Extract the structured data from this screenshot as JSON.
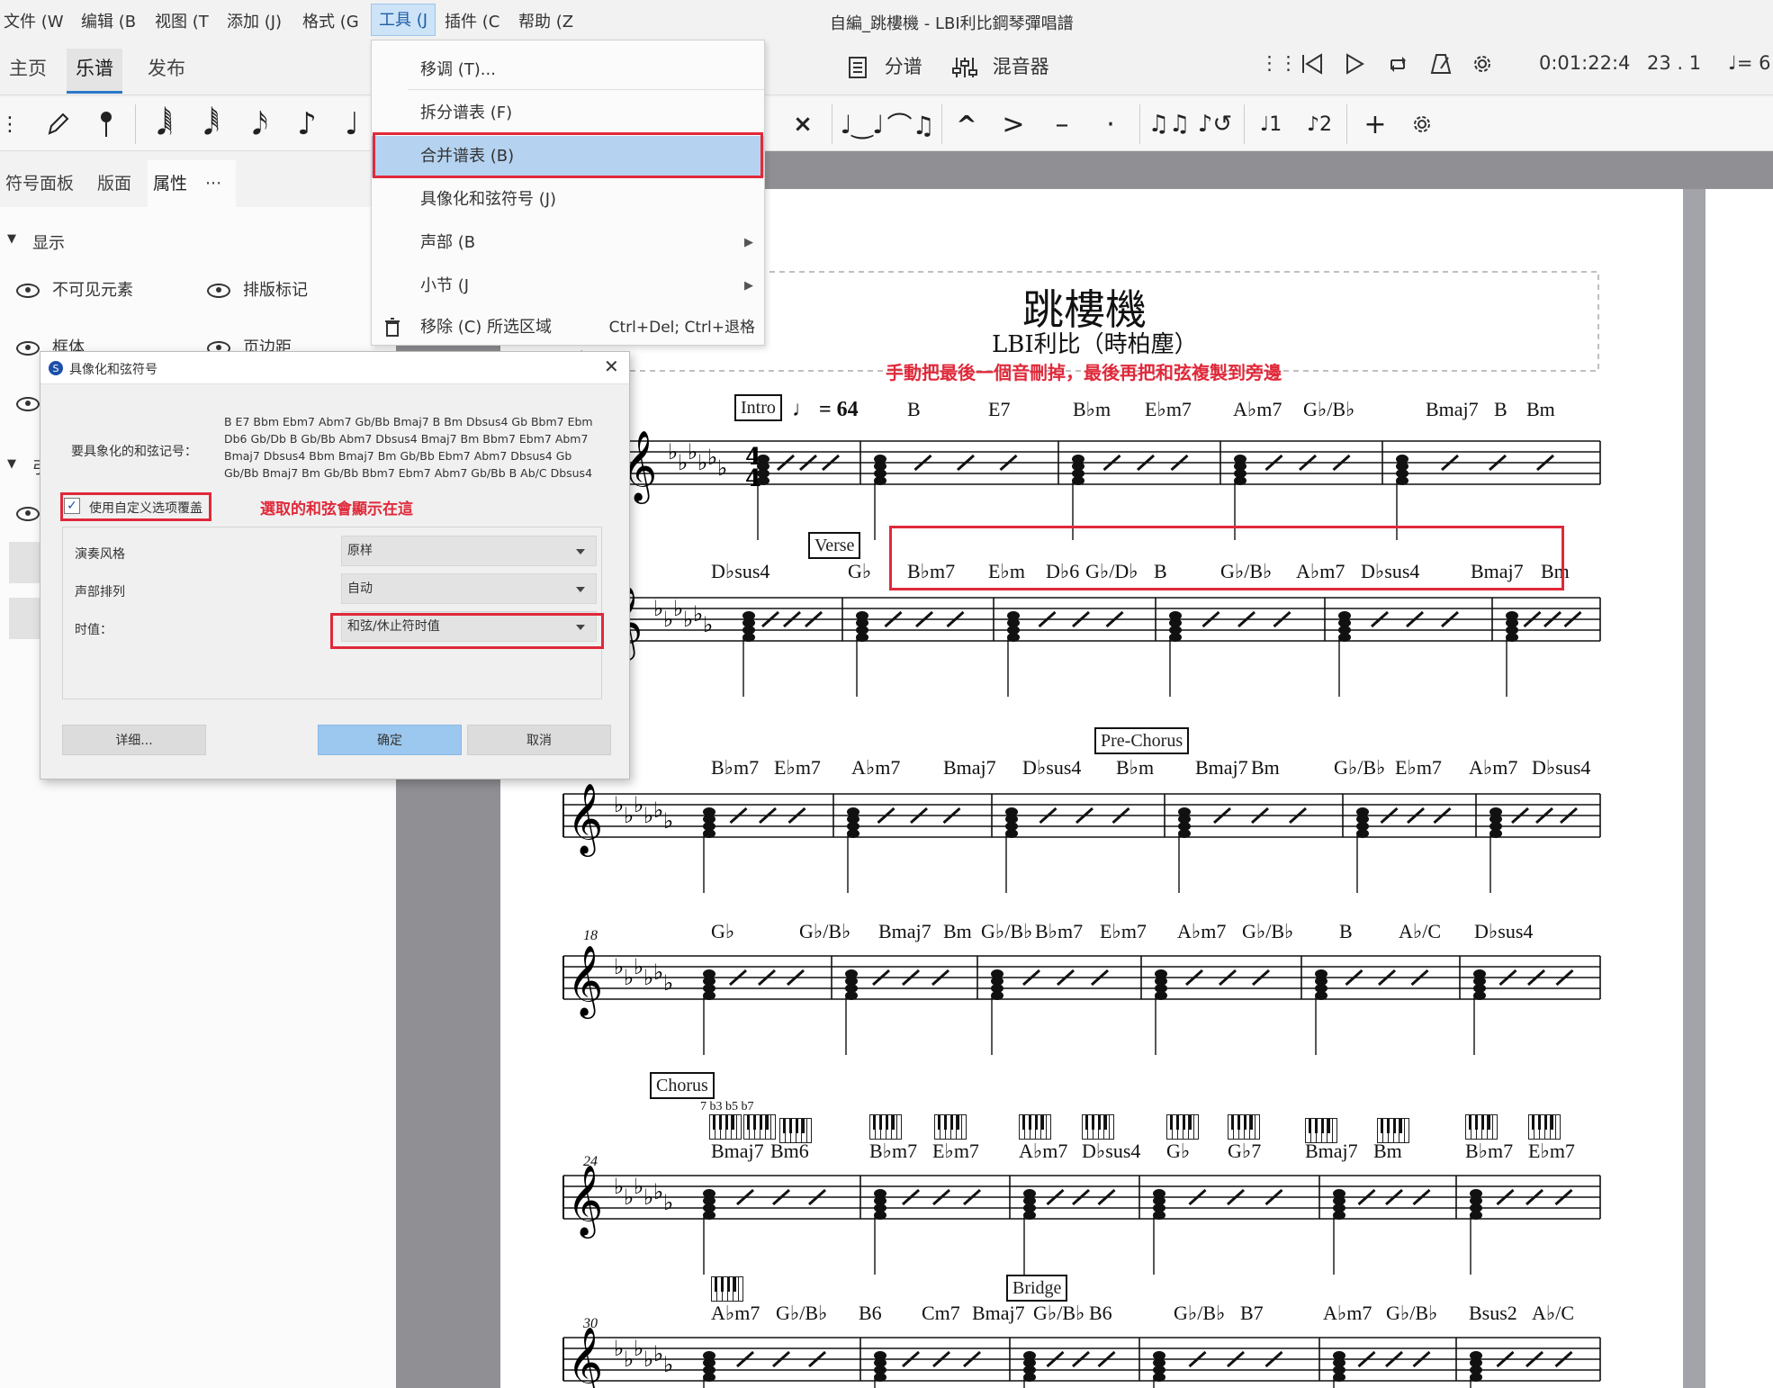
{
  "window": {
    "title": "自編_跳樓機 - LBI利比鋼琴彈唱譜"
  },
  "menubar": [
    "文件 (W",
    "编辑 (B",
    "视图 (T",
    "添加 (J)",
    "格式 (G",
    "工具 (J",
    "插件 (C",
    "帮助 (Z"
  ],
  "main_tabs": [
    "主页",
    "乐谱",
    "发布"
  ],
  "right_toolbar": {
    "parts_label": "分谱",
    "mixer_label": "混音器",
    "time": "0:01:22:4",
    "position": "23 . 1",
    "tempo_prefix": "= 6"
  },
  "left_panel": {
    "tabs": [
      "符号面板",
      "版面",
      "属性"
    ],
    "more": "···",
    "section_display": "显示",
    "items": [
      "不可见元素",
      "排版标记",
      "框体",
      "页边距"
    ],
    "section2_partial": "引"
  },
  "tools_menu": {
    "items": [
      {
        "label": "移调 (T)...",
        "submenu": false
      },
      {
        "label": "拆分谱表 (F)",
        "submenu": false
      },
      {
        "label": "合并谱表 (B)",
        "submenu": false,
        "highlighted": true
      },
      {
        "label": "具像化和弦符号 (J)",
        "submenu": false
      },
      {
        "label": "声部 (B",
        "submenu": true
      },
      {
        "label": "小节 (J",
        "submenu": true
      },
      {
        "label": "移除 (C) 所选区域",
        "submenu": false,
        "shortcut": "Ctrl+Del; Ctrl+退格"
      }
    ]
  },
  "dialog": {
    "title": "具像化和弦符号",
    "chords_label": "要具象化的和弦记号：",
    "chords_text": "B E7 Bbm Ebm7 Abm7 Gb/Bb Bmaj7 B Bm Dbsus4 Gb Bbm7 Ebm Db6 Gb/Db B Gb/Bb Abm7 Dbsus4 Bmaj7 Bm Bbm7 Ebm7 Abm7 Bmaj7 Dbsus4 Bbm Bmaj7 Bm Gb/Bb Ebm7 Abm7 Dbsus4 Gb Gb/Bb Bmaj7 Bm Gb/Bb Bbm7 Ebm7 Abm7 Gb/Bb B Ab/C Dbsus4",
    "checkbox_label": "使用自定义选项覆盖",
    "checkbox_checked": true,
    "style_label": "演奏风格",
    "style_value": "原样",
    "voicing_label": "声部排列",
    "voicing_value": "自动",
    "duration_label": "时值：",
    "duration_value": "和弦/休止符时值",
    "details_button": "详细...",
    "ok_button": "确定",
    "cancel_button": "取消"
  },
  "annotations": {
    "selected_chords_note": "選取的和弦會顯示在這",
    "manual_note": "手動把最後一個音刪掉，最後再把和弦複製到旁邊"
  },
  "score": {
    "title": "跳樓機",
    "subtitle": "LBI利比（時柏塵）",
    "tempo": "= 64",
    "time_signature": "4/4",
    "rehearsal_marks": [
      "Intro",
      "Verse",
      "Pre-Chorus",
      "Chorus",
      "Bridge"
    ],
    "measure_numbers": [
      "18",
      "24",
      "30"
    ],
    "keyboard_annotation": "7 b3 b5 b7",
    "systems": [
      [
        "B",
        "E7",
        "B♭m",
        "E♭m7",
        "A♭m7",
        "G♭/B♭",
        "Bmaj7",
        "B",
        "Bm"
      ],
      [
        "D♭sus4",
        "G♭",
        "B♭m7",
        "E♭m",
        "D♭6",
        "G♭/D♭",
        "B",
        "G♭/B♭",
        "A♭m7",
        "D♭sus4",
        "Bmaj7",
        "Bm"
      ],
      [
        "B♭m7",
        "E♭m7",
        "A♭m7",
        "Bmaj7",
        "D♭sus4",
        "B♭m",
        "Bmaj7",
        "Bm",
        "G♭/B♭",
        "E♭m7",
        "A♭m7",
        "D♭sus4"
      ],
      [
        "G♭",
        "G♭/B♭",
        "Bmaj7",
        "Bm",
        "G♭/B♭",
        "B♭m7",
        "E♭m7",
        "A♭m7",
        "G♭/B♭",
        "B",
        "A♭/C",
        "D♭sus4"
      ],
      [
        "Bmaj7",
        "Bm6",
        "B♭m7",
        "E♭m7",
        "A♭m7",
        "D♭sus4",
        "G♭",
        "G♭7",
        "Bmaj7",
        "Bm",
        "B♭m7",
        "E♭m7"
      ],
      [
        "A♭m7",
        "G♭/B♭",
        "B6",
        "Cm7",
        "Bmaj7",
        "G♭/B♭",
        "B6",
        "G♭/B♭",
        "B7",
        "A♭m7",
        "G♭/B♭",
        "Bsus2",
        "A♭/C"
      ]
    ]
  }
}
